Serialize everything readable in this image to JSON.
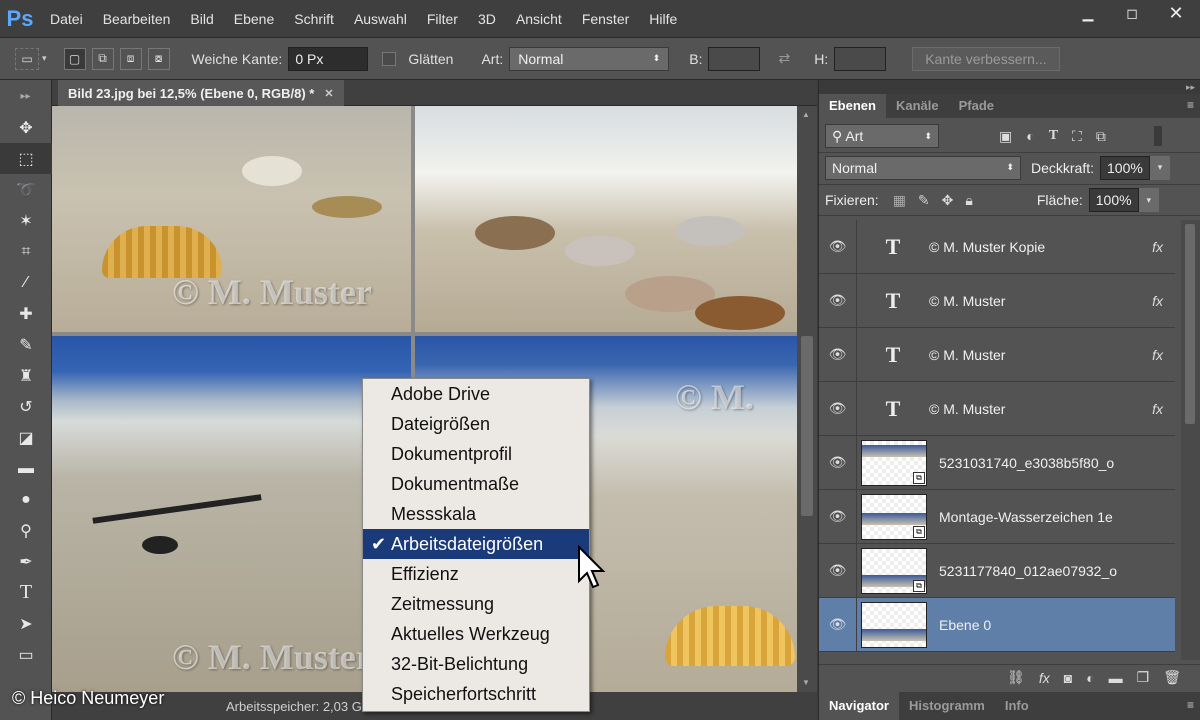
{
  "app": {
    "logo": "Ps"
  },
  "menu": [
    "Datei",
    "Bearbeiten",
    "Bild",
    "Ebene",
    "Schrift",
    "Auswahl",
    "Filter",
    "3D",
    "Ansicht",
    "Fenster",
    "Hilfe"
  ],
  "options": {
    "feather_label": "Weiche Kante:",
    "feather_value": "0 Px",
    "antialias_label": "Glätten",
    "style_label": "Art:",
    "style_value": "Normal",
    "width_label": "B:",
    "height_label": "H:",
    "refine_button": "Kante verbessern..."
  },
  "document": {
    "tab_title": "Bild 23.jpg bei 12,5% (Ebene 0, RGB/8) *",
    "watermark": "© M. Muster",
    "watermark_short": "© M."
  },
  "status": {
    "text": "Arbeitsspeicher: 2,03 GB/10..."
  },
  "credit": "© Heico Neumeyer",
  "status_menu": {
    "items": [
      "Adobe Drive",
      "Dateigrößen",
      "Dokumentprofil",
      "Dokumentmaße",
      "Messskala",
      "Arbeitsdateigrößen",
      "Effizienz",
      "Zeitmessung",
      "Aktuelles Werkzeug",
      "32-Bit-Belichtung",
      "Speicherfortschritt"
    ],
    "selected": "Arbeitsdateigrößen"
  },
  "layers_panel": {
    "tabs": [
      "Ebenen",
      "Kanäle",
      "Pfade"
    ],
    "filter_value": "Art",
    "blend_mode": "Normal",
    "opacity_label": "Deckkraft:",
    "opacity_value": "100%",
    "lock_label": "Fixieren:",
    "fill_label": "Fläche:",
    "fill_value": "100%",
    "fx_label": "fx",
    "text_layer_glyph": "T",
    "layers": [
      {
        "name": "© M. Muster Kopie",
        "type": "text"
      },
      {
        "name": "© M. Muster",
        "type": "text"
      },
      {
        "name": "© M. Muster",
        "type": "text"
      },
      {
        "name": "© M. Muster",
        "type": "text"
      },
      {
        "name": "5231031740_e3038b5f80_o",
        "type": "smart"
      },
      {
        "name": "Montage-Wasserzeichen 1e",
        "type": "smart"
      },
      {
        "name": "5231177840_012ae07932_o",
        "type": "smart"
      },
      {
        "name": "Ebene 0",
        "type": "image",
        "selected": true
      }
    ]
  },
  "bottom_tabs": [
    "Navigator",
    "Histogramm",
    "Info"
  ],
  "colors": {
    "selection": "#1a3a7a",
    "layer_selected": "#5f7ea8",
    "ps_blue": "#5aa9ff"
  }
}
